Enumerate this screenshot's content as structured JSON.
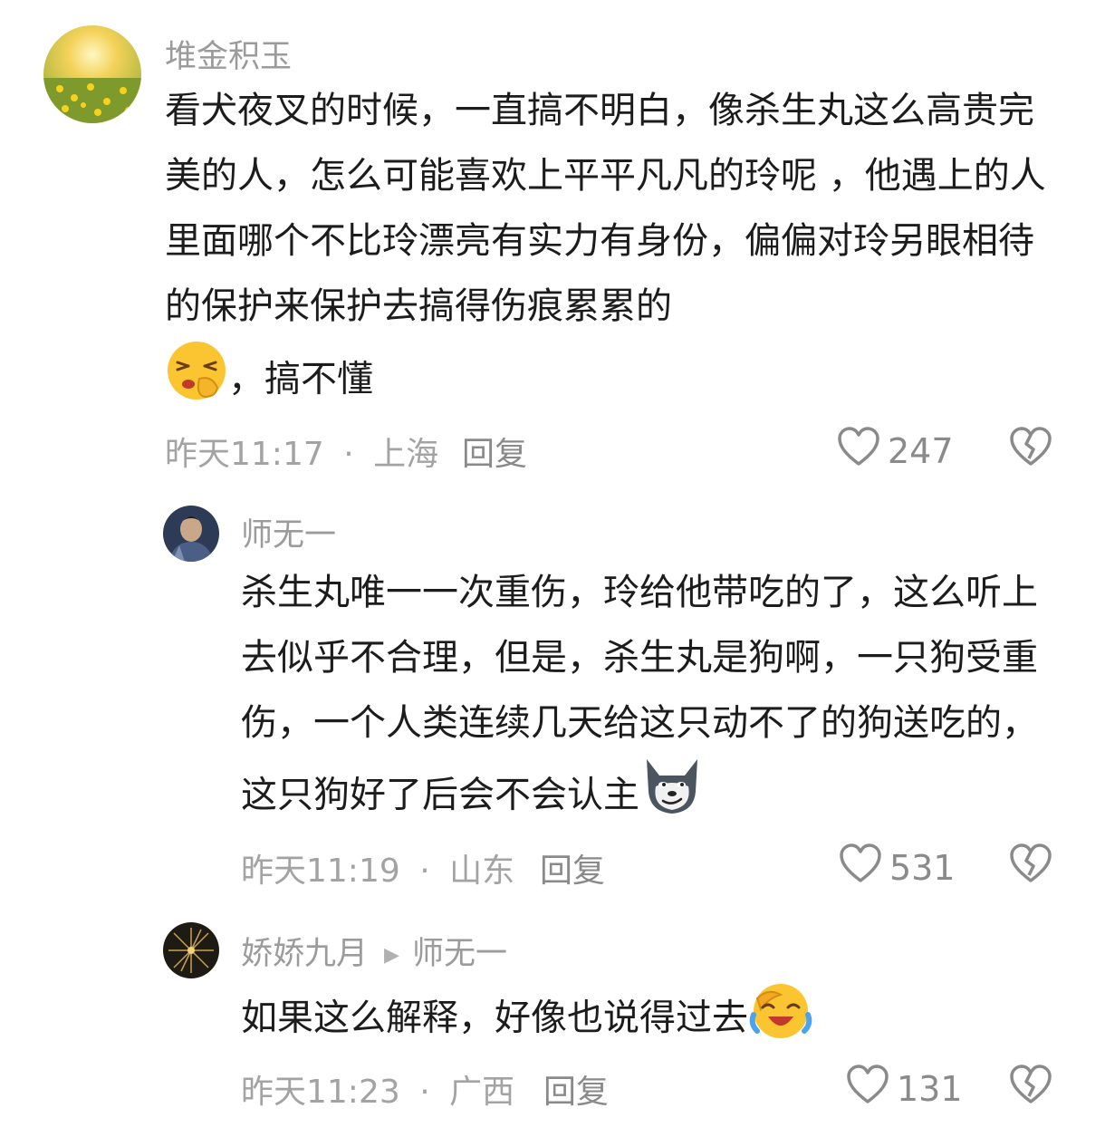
{
  "comments": [
    {
      "username": "堆金积玉",
      "text": "看犬夜叉的时候，一直搞不明白，像杀生丸这么高贵完美的人，怎么可能喜欢上平平凡凡的玲呢 ，他遇上的人里面哪个不比玲漂亮有实力有身份，偏偏对玲另眼相待的保护来保护去搞得伤痕累累的",
      "text_after_emoji": "，搞不懂",
      "emoji": "shushing-face-emoji",
      "time": "昨天11:17",
      "sep": "·",
      "location": "上海",
      "reply_label": "回复",
      "likes": "247"
    },
    {
      "username": "师无一",
      "text": "杀生丸唯一一次重伤，玲给他带吃的了，这么听上去似乎不合理，但是，杀生丸是狗啊，一只狗受重伤，一个人类连续几天给这只动不了的狗送吃的，这只狗好了后会不会认主",
      "emoji": "wolf-face-emoji",
      "time": "昨天11:19",
      "sep": "·",
      "location": "山东",
      "reply_label": "回复",
      "likes": "531"
    },
    {
      "username": "娇娇九月",
      "reply_to": "师无一",
      "text": "如果这么解释，好像也说得过去",
      "emoji": "laughing-crying-emoji",
      "time": "昨天11:23",
      "sep": "·",
      "location": "广西",
      "reply_label": "回复",
      "likes": "131"
    }
  ],
  "icons": {
    "like": "heart-outline-icon",
    "dislike": "broken-heart-icon"
  },
  "colors": {
    "username": "#9b9b9b",
    "meta": "#a3a3a3",
    "text": "#1c1c1c"
  }
}
